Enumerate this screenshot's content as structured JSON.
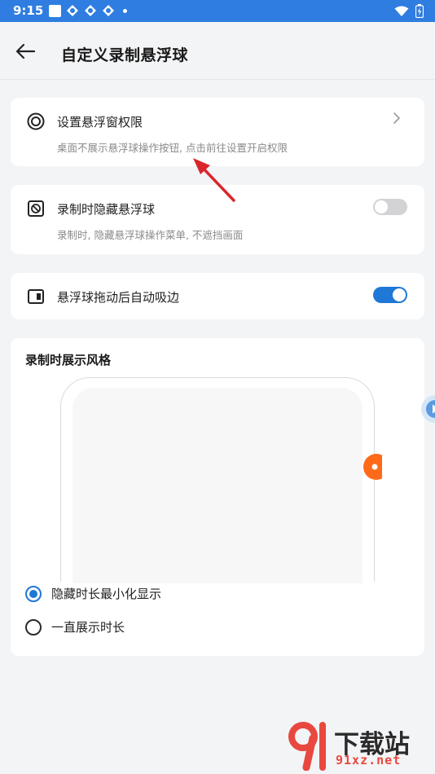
{
  "status_bar": {
    "time": "9:15"
  },
  "header": {
    "title": "自定义录制悬浮球"
  },
  "settings": {
    "permission": {
      "title": "设置悬浮窗权限",
      "subtitle": "桌面不展示悬浮球操作按钮, 点击前往设置开启权限"
    },
    "hide_during_record": {
      "title": "录制时隐藏悬浮球",
      "subtitle": "录制时, 隐藏悬浮球操作菜单, 不遮挡画面",
      "enabled": false
    },
    "auto_edge": {
      "title": "悬浮球拖动后自动吸边",
      "enabled": true
    }
  },
  "display_style": {
    "title": "录制时展示风格",
    "options": [
      {
        "label": "隐藏时长最小化显示",
        "selected": true
      },
      {
        "label": "一直展示时长",
        "selected": false
      }
    ]
  },
  "watermark": {
    "text": "下载站",
    "url": "91xz.net"
  },
  "colors": {
    "accent": "#1f78d6",
    "status_bar": "#2f7de0",
    "floating_ball": "#ff6a1a",
    "annotation_arrow": "#d9262c"
  }
}
